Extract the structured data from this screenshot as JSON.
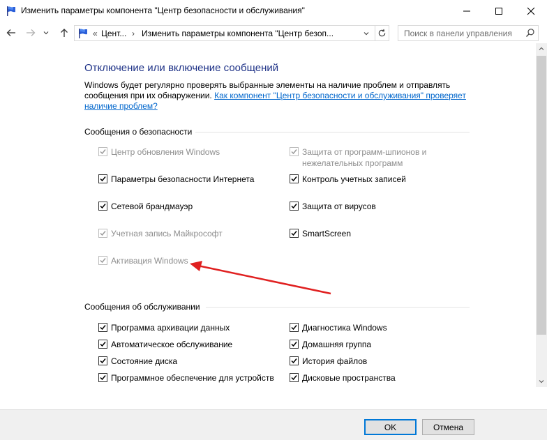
{
  "window": {
    "title": "Изменить параметры компонента \"Центр безопасности и обслуживания\""
  },
  "address": {
    "prefix": "«",
    "crumb1": "Цент...",
    "arrow": "›",
    "crumb2": "Изменить параметры компонента \"Центр безоп..."
  },
  "search": {
    "placeholder": "Поиск в панели управления"
  },
  "page": {
    "title": "Отключение или включение сообщений",
    "description": "Windows будет регулярно проверять выбранные элементы на наличие проблем и отправлять сообщения при их обнаружении.",
    "link": "Как компонент \"Центр безопасности и обслуживания\" проверяет наличие проблем?"
  },
  "security": {
    "header": "Сообщения о безопасности",
    "items": [
      {
        "label": "Центр обновления Windows",
        "checked": true,
        "disabled": true
      },
      {
        "label": "Защита от программ-шпионов и",
        "label2": "нежелательных программ",
        "checked": true,
        "disabled": true
      },
      {
        "label": "Параметры безопасности Интернета",
        "checked": true,
        "disabled": false
      },
      {
        "label": "Контроль учетных записей",
        "checked": true,
        "disabled": false
      },
      {
        "label": "Сетевой брандмауэр",
        "checked": true,
        "disabled": false
      },
      {
        "label": "Защита от вирусов",
        "checked": true,
        "disabled": false
      },
      {
        "label": "Учетная запись Майкрософт",
        "checked": true,
        "disabled": true
      },
      {
        "label": "SmartScreen",
        "checked": true,
        "disabled": false
      },
      {
        "label": "Активация Windows",
        "checked": true,
        "disabled": true
      }
    ]
  },
  "maintenance": {
    "header": "Сообщения об обслуживании",
    "items": [
      {
        "label": "Программа архивации данных",
        "checked": true
      },
      {
        "label": "Диагностика Windows",
        "checked": true
      },
      {
        "label": "Автоматическое обслуживание",
        "checked": true
      },
      {
        "label": "Домашняя группа",
        "checked": true
      },
      {
        "label": "Состояние диска",
        "checked": true
      },
      {
        "label": "История файлов",
        "checked": true
      },
      {
        "label": "Программное обеспечение для устройств",
        "checked": true
      },
      {
        "label": "Дисковые пространства",
        "checked": true
      }
    ]
  },
  "footer": {
    "ok_label": "OK",
    "cancel_label": "Отмена"
  },
  "colors": {
    "title_blue": "#1e3287",
    "link_blue": "#0066cc",
    "annotation_red": "#e02020",
    "ok_border": "#0078d7"
  }
}
